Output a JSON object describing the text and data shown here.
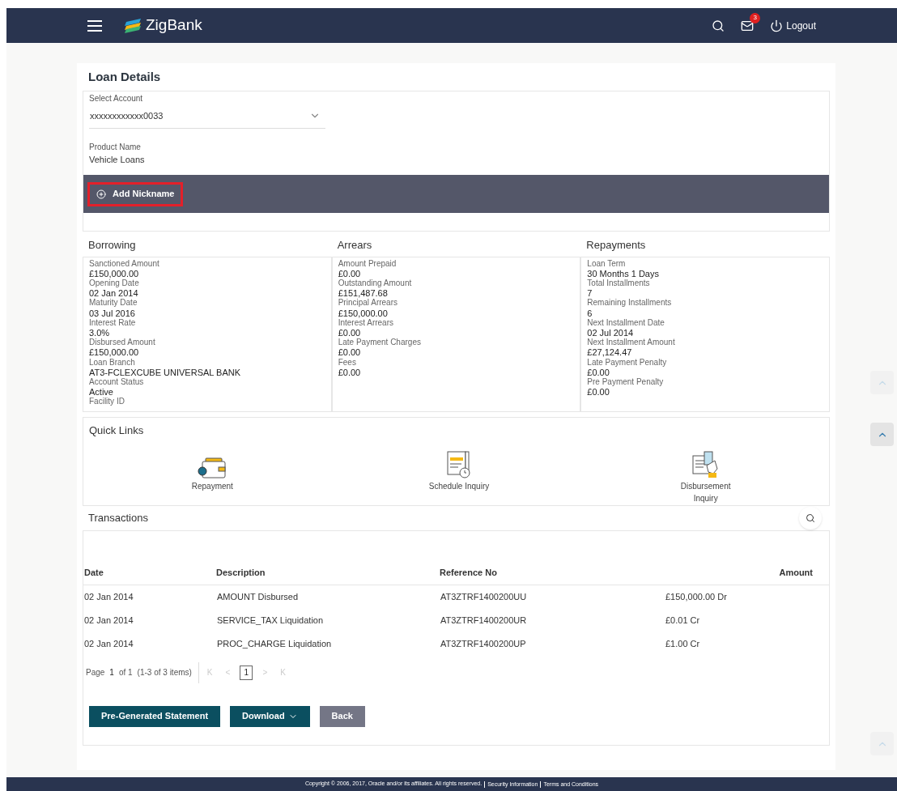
{
  "header": {
    "brand": "ZigBank",
    "mail_count": "3",
    "logout": "Logout"
  },
  "title": "Loan Details",
  "account": {
    "label": "Select Account",
    "value": "xxxxxxxxxxxx0033"
  },
  "product": {
    "label": "Product Name",
    "value": "Vehicle Loans"
  },
  "nickname_button": "Add Nickname",
  "sections": [
    {
      "title": "Borrowing",
      "fields": [
        {
          "label": "Sanctioned Amount",
          "value": "£150,000.00"
        },
        {
          "label": "Opening Date",
          "value": "02 Jan 2014"
        },
        {
          "label": "Maturity Date",
          "value": "03 Jul 2016"
        },
        {
          "label": "Interest Rate",
          "value": "3.0%"
        },
        {
          "label": "Disbursed Amount",
          "value": "£150,000.00"
        },
        {
          "label": "Loan Branch",
          "value": "AT3-FCLEXCUBE UNIVERSAL BANK"
        },
        {
          "label": "Account Status",
          "value": "Active"
        },
        {
          "label": "Facility ID"
        }
      ]
    },
    {
      "title": "Arrears",
      "fields": [
        {
          "label": "Amount Prepaid",
          "value": "£0.00"
        },
        {
          "label": "Outstanding Amount",
          "value": "£151,487.68"
        },
        {
          "label": "Principal Arrears",
          "value": "£150,000.00"
        },
        {
          "label": "Interest Arrears",
          "value": "£0.00"
        },
        {
          "label": "Late Payment Charges",
          "value": "£0.00"
        },
        {
          "label": "Fees",
          "value": "£0.00"
        }
      ]
    },
    {
      "title": "Repayments",
      "fields": [
        {
          "label": "Loan Term",
          "value": "30 Months 1 Days"
        },
        {
          "label": "Total Installments",
          "value": "7"
        },
        {
          "label": "Remaining Installments",
          "value": "6"
        },
        {
          "label": "Next Installment Date",
          "value": "02 Jul 2014"
        },
        {
          "label": "Next Installment Amount",
          "value": "£27,124.47"
        },
        {
          "label": "Late Payment Penalty",
          "value": "£0.00"
        },
        {
          "label": "Pre Payment Penalty",
          "value": "£0.00"
        }
      ]
    }
  ],
  "quick_links": {
    "title": "Quick Links",
    "items": [
      {
        "kind": "wallet",
        "label": "Repayment"
      },
      {
        "kind": "schedule",
        "label": "Schedule Inquiry"
      },
      {
        "kind": "disbursement",
        "label": "Disbursement Inquiry"
      }
    ]
  },
  "transactions": {
    "title": "Transactions",
    "columns": [
      "Date",
      "Description",
      "Reference No",
      "Amount"
    ],
    "rows": [
      [
        "02 Jan 2014",
        "AMOUNT Disbursed",
        "AT3ZTRF1400200UU",
        "£150,000.00 Dr"
      ],
      [
        "02 Jan 2014",
        "SERVICE_TAX Liquidation",
        "AT3ZTRF1400200UR",
        "£0.01 Cr"
      ],
      [
        "02 Jan 2014",
        "PROC_CHARGE Liquidation",
        "AT3ZTRF1400200UP",
        "£1.00 Cr"
      ]
    ],
    "pagination": {
      "page_label": "Page",
      "page": "1",
      "of": "of 1",
      "items": "(1-3 of 3 items)",
      "first": "K",
      "prev": "<",
      "current": "1",
      "next": ">",
      "last": "K"
    }
  },
  "buttons": [
    {
      "kind": "primary",
      "label": "Pre-Generated Statement"
    },
    {
      "kind": "dropdown",
      "label": "Download"
    },
    {
      "kind": "secondary",
      "label": "Back"
    }
  ],
  "footer": {
    "copyright": "Copyright © 2006, 2017, Oracle and/or its affiliates. All rights reserved.",
    "links": [
      "Security Information",
      "Terms and Conditions"
    ]
  }
}
